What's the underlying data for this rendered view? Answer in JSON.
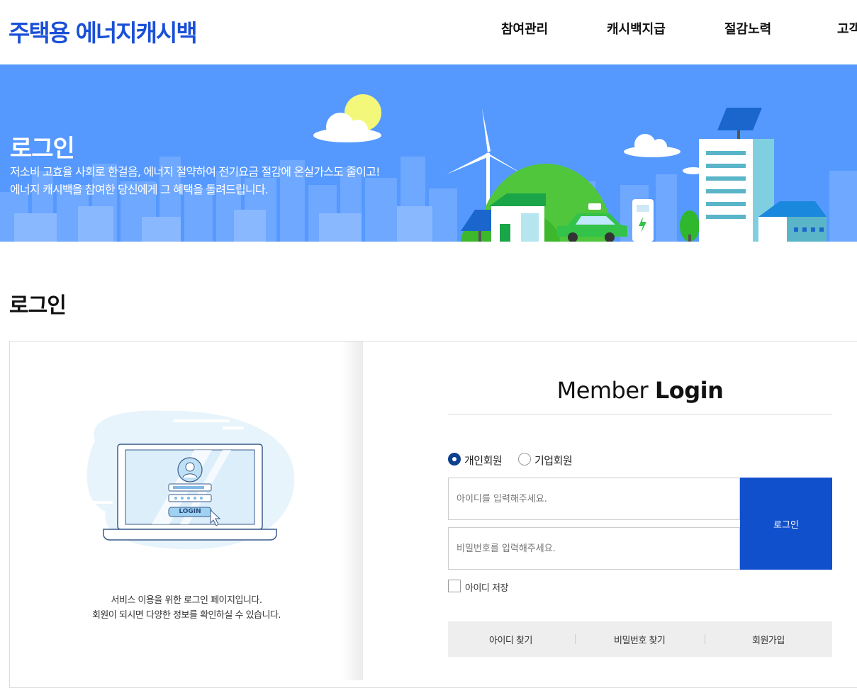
{
  "header": {
    "logo": "주택용 에너지캐시백",
    "nav": [
      "참여관리",
      "캐시백지급",
      "절감노력",
      "고객"
    ]
  },
  "banner": {
    "title": "로그인",
    "desc_line1": "저소비 고효율 사회로 한걸음, 에너지 절약하여 전기요금 절감에 온실가스도 줄이고!",
    "desc_line2": "에너지 캐시백을 참여한 당신에게 그 혜택을 돌려드립니다."
  },
  "page": {
    "title": "로그인"
  },
  "left": {
    "illustration_button": "LOGIN",
    "desc_line1": "서비스 이용을 위한 로그인 페이지입니다.",
    "desc_line2": "회원이 되시면 다양한 정보를 확인하실 수 있습니다."
  },
  "form": {
    "title_light": "Member",
    "title_bold": "Login",
    "radio_personal": "개인회원",
    "radio_company": "기업회원",
    "id_placeholder": "아이디를 입력해주세요.",
    "pw_placeholder": "비밀번호를 입력해주세요.",
    "login_button": "로그인",
    "save_id": "아이디 저장",
    "find_id": "아이디 찾기",
    "find_pw": "비밀번호 찾기",
    "join": "회원가입"
  },
  "colors": {
    "brand": "#1a4fd8",
    "banner_bg": "#5599ff",
    "login_button": "#1150cc",
    "radio_selected": "#0f3f8f"
  }
}
